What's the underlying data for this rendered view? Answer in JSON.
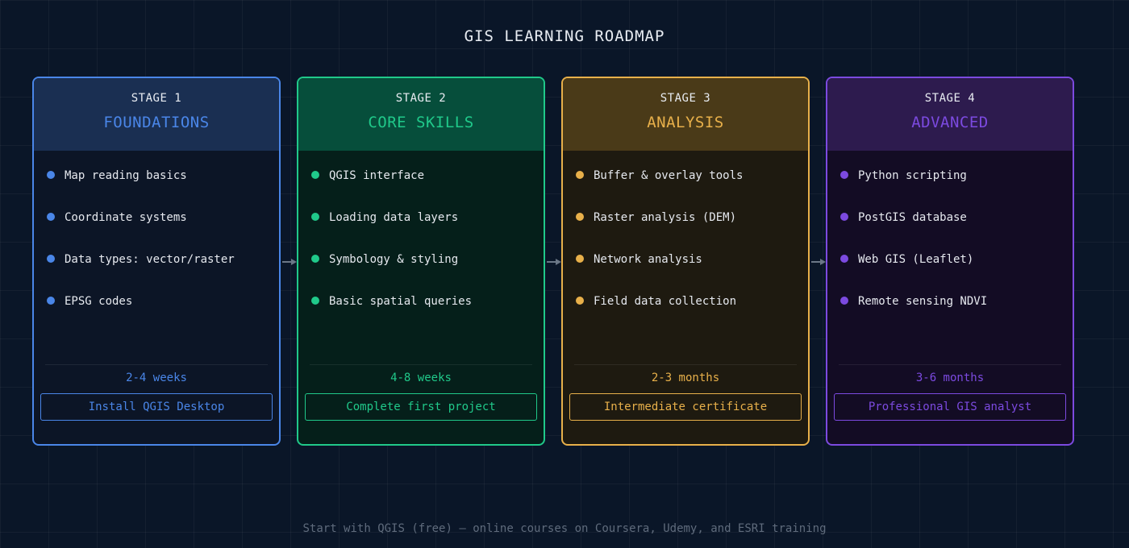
{
  "title": "GIS LEARNING ROADMAP",
  "stages": [
    {
      "label": "STAGE 1",
      "name": "FOUNDATIONS",
      "items": [
        "Map reading basics",
        "Coordinate systems",
        "Data types: vector/raster",
        "EPSG codes"
      ],
      "duration": "2-4 weeks",
      "outcome": "Install QGIS Desktop",
      "colors": {
        "accent": "#4a86e8",
        "header": "#1a2f52",
        "body": "#0c1526",
        "border": "#4a86e8"
      }
    },
    {
      "label": "STAGE 2",
      "name": "CORE SKILLS",
      "items": [
        "QGIS interface",
        "Loading data layers",
        "Symbology & styling",
        "Basic spatial queries"
      ],
      "duration": "4-8 weeks",
      "outcome": "Complete first project",
      "colors": {
        "accent": "#20c98a",
        "header": "#064e3b",
        "body": "#051f1a",
        "border": "#20c98a"
      }
    },
    {
      "label": "STAGE 3",
      "name": "ANALYSIS",
      "items": [
        "Buffer & overlay tools",
        "Raster analysis (DEM)",
        "Network analysis",
        "Field data collection"
      ],
      "duration": "2-3 months",
      "outcome": "Intermediate certificate",
      "colors": {
        "accent": "#e8b04a",
        "header": "#4a3a18",
        "body": "#1e1a10",
        "border": "#e8b04a"
      }
    },
    {
      "label": "STAGE 4",
      "name": "ADVANCED",
      "items": [
        "Python scripting",
        "PostGIS database",
        "Web GIS (Leaflet)",
        "Remote sensing NDVI"
      ],
      "duration": "3-6 months",
      "outcome": "Professional GIS analyst",
      "colors": {
        "accent": "#7c4ae0",
        "header": "#2d1b4e",
        "body": "#130c24",
        "border": "#7c4ae0"
      }
    }
  ],
  "connector_color": "#6b7787",
  "footer": "Start with QGIS (free) — online courses on Coursera, Udemy, and ESRI training"
}
